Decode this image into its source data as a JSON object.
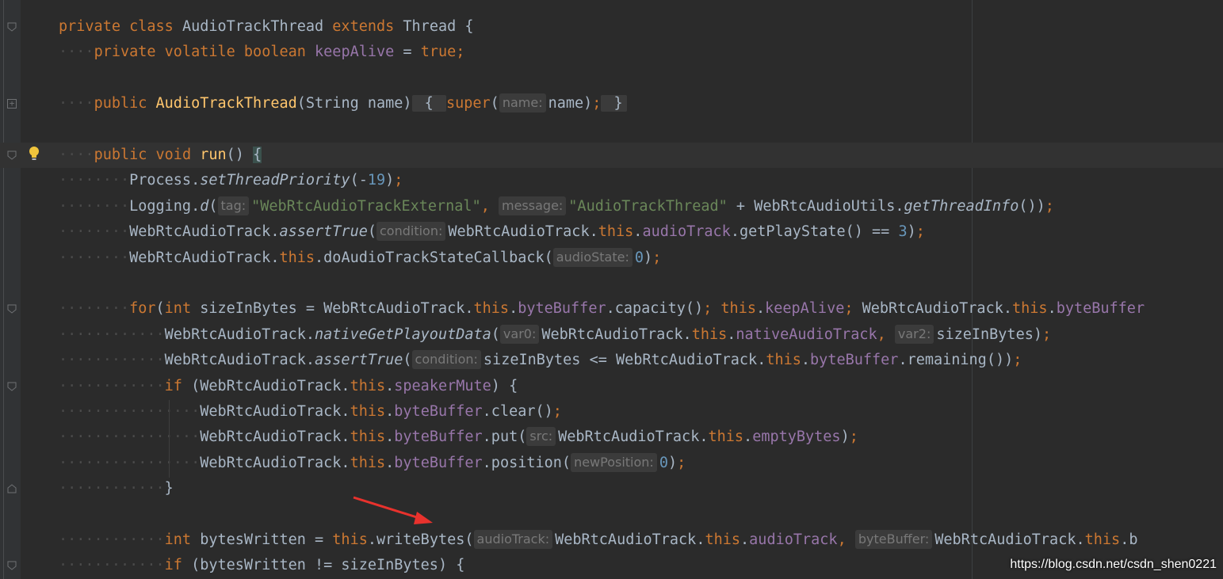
{
  "editor": {
    "lines": [
      {
        "dots": "",
        "tokens": [
          [
            "kw",
            "private "
          ],
          [
            "kw",
            "class "
          ],
          [
            "",
            "AudioTrackThread "
          ],
          [
            "kw",
            "extends "
          ],
          [
            "",
            "Thread {"
          ]
        ]
      },
      {
        "dots": "····",
        "tokens": [
          [
            "kw",
            "private "
          ],
          [
            "kw",
            "volatile "
          ],
          [
            "kw",
            "boolean "
          ],
          [
            "fld",
            "keepAlive"
          ],
          [
            "",
            " = "
          ],
          [
            "kw",
            "true"
          ],
          [
            "kw",
            ";"
          ]
        ]
      },
      {
        "dots": "",
        "tokens": []
      },
      {
        "dots": "····",
        "tokens": [
          [
            "kw",
            "public "
          ],
          [
            "mth",
            "AudioTrackThread"
          ],
          [
            "",
            "(String name)"
          ],
          [
            "fold",
            " { "
          ],
          [
            "kw",
            "super"
          ],
          [
            "",
            "("
          ],
          [
            "hint",
            "name:"
          ],
          [
            "",
            "name)"
          ],
          [
            "kw",
            ";"
          ],
          [
            "fold",
            " }"
          ]
        ]
      },
      {
        "dots": "",
        "tokens": []
      },
      {
        "dots": "····",
        "current": true,
        "tokens": [
          [
            "kw",
            "public "
          ],
          [
            "kw",
            "void "
          ],
          [
            "mth",
            "run"
          ],
          [
            "",
            "() "
          ],
          [
            "brace",
            "{"
          ]
        ]
      },
      {
        "dots": "········",
        "tokens": [
          [
            "",
            "Process."
          ],
          [
            "st",
            "setThreadPriority"
          ],
          [
            "",
            "(-"
          ],
          [
            "num",
            "19"
          ],
          [
            "",
            ")"
          ],
          [
            "kw",
            ";"
          ]
        ]
      },
      {
        "dots": "········",
        "tokens": [
          [
            "",
            "Logging."
          ],
          [
            "st",
            "d"
          ],
          [
            "",
            "("
          ],
          [
            "hint",
            "tag:"
          ],
          [
            "str",
            "\"WebRtcAudioTrackExternal\""
          ],
          [
            "kw",
            ","
          ],
          [
            "",
            " "
          ],
          [
            "hint",
            "message:"
          ],
          [
            "str",
            "\"AudioTrackThread\""
          ],
          [
            "",
            " + WebRtcAudioUtils."
          ],
          [
            "st",
            "getThreadInfo"
          ],
          [
            "",
            "())"
          ],
          [
            "kw",
            ";"
          ]
        ]
      },
      {
        "dots": "········",
        "tokens": [
          [
            "",
            "WebRtcAudioTrack."
          ],
          [
            "st",
            "assertTrue"
          ],
          [
            "",
            "("
          ],
          [
            "hint",
            "condition:"
          ],
          [
            "",
            "WebRtcAudioTrack."
          ],
          [
            "kw",
            "this"
          ],
          [
            "",
            "."
          ],
          [
            "fld",
            "audioTrack"
          ],
          [
            "",
            ".getPlayState() == "
          ],
          [
            "num",
            "3"
          ],
          [
            "",
            ")"
          ],
          [
            "kw",
            ";"
          ]
        ]
      },
      {
        "dots": "········",
        "tokens": [
          [
            "",
            "WebRtcAudioTrack."
          ],
          [
            "kw",
            "this"
          ],
          [
            "",
            ".doAudioTrackStateCallback("
          ],
          [
            "hint",
            "audioState:"
          ],
          [
            "num",
            "0"
          ],
          [
            "",
            ")"
          ],
          [
            "kw",
            ";"
          ]
        ]
      },
      {
        "dots": "",
        "tokens": []
      },
      {
        "dots": "········",
        "tokens": [
          [
            "kw",
            "for"
          ],
          [
            "",
            "("
          ],
          [
            "kw",
            "int "
          ],
          [
            "",
            "sizeInBytes = WebRtcAudioTrack."
          ],
          [
            "kw",
            "this"
          ],
          [
            "",
            "."
          ],
          [
            "fld",
            "byteBuffer"
          ],
          [
            "",
            ".capacity()"
          ],
          [
            "kw",
            "; this"
          ],
          [
            "",
            "."
          ],
          [
            "fld",
            "keepAlive"
          ],
          [
            "kw",
            "; "
          ],
          [
            "",
            "WebRtcAudioTrack."
          ],
          [
            "kw",
            "this"
          ],
          [
            "",
            "."
          ],
          [
            "fld",
            "byteBuffer"
          ]
        ]
      },
      {
        "dots": "············",
        "tokens": [
          [
            "",
            "WebRtcAudioTrack."
          ],
          [
            "st",
            "nativeGetPlayoutData"
          ],
          [
            "",
            "("
          ],
          [
            "hint",
            "var0:"
          ],
          [
            "",
            "WebRtcAudioTrack."
          ],
          [
            "kw",
            "this"
          ],
          [
            "",
            "."
          ],
          [
            "fld",
            "nativeAudioTrack"
          ],
          [
            "kw",
            ","
          ],
          [
            "",
            " "
          ],
          [
            "hint",
            "var2:"
          ],
          [
            "",
            "sizeInBytes)"
          ],
          [
            "kw",
            ";"
          ]
        ]
      },
      {
        "dots": "············",
        "tokens": [
          [
            "",
            "WebRtcAudioTrack."
          ],
          [
            "st",
            "assertTrue"
          ],
          [
            "",
            "("
          ],
          [
            "hint",
            "condition:"
          ],
          [
            "",
            "sizeInBytes <= WebRtcAudioTrack."
          ],
          [
            "kw",
            "this"
          ],
          [
            "",
            "."
          ],
          [
            "fld",
            "byteBuffer"
          ],
          [
            "",
            ".remaining())"
          ],
          [
            "kw",
            ";"
          ]
        ]
      },
      {
        "dots": "············",
        "tokens": [
          [
            "kw",
            "if "
          ],
          [
            "",
            "(WebRtcAudioTrack."
          ],
          [
            "kw",
            "this"
          ],
          [
            "",
            "."
          ],
          [
            "fld",
            "speakerMute"
          ],
          [
            "",
            ") {"
          ]
        ]
      },
      {
        "dots": "················",
        "tokens": [
          [
            "",
            "WebRtcAudioTrack."
          ],
          [
            "kw",
            "this"
          ],
          [
            "",
            "."
          ],
          [
            "fld",
            "byteBuffer"
          ],
          [
            "",
            ".clear()"
          ],
          [
            "kw",
            ";"
          ]
        ]
      },
      {
        "dots": "················",
        "tokens": [
          [
            "",
            "WebRtcAudioTrack."
          ],
          [
            "kw",
            "this"
          ],
          [
            "",
            "."
          ],
          [
            "fld",
            "byteBuffer"
          ],
          [
            "",
            ".put("
          ],
          [
            "hint",
            "src:"
          ],
          [
            "",
            "WebRtcAudioTrack."
          ],
          [
            "kw",
            "this"
          ],
          [
            "",
            "."
          ],
          [
            "fld",
            "emptyBytes"
          ],
          [
            "",
            ")"
          ],
          [
            "kw",
            ";"
          ]
        ]
      },
      {
        "dots": "················",
        "tokens": [
          [
            "",
            "WebRtcAudioTrack."
          ],
          [
            "kw",
            "this"
          ],
          [
            "",
            "."
          ],
          [
            "fld",
            "byteBuffer"
          ],
          [
            "",
            ".position("
          ],
          [
            "hint",
            "newPosition:"
          ],
          [
            "num",
            "0"
          ],
          [
            "",
            ")"
          ],
          [
            "kw",
            ";"
          ]
        ]
      },
      {
        "dots": "············",
        "tokens": [
          [
            "",
            "}"
          ]
        ]
      },
      {
        "dots": "",
        "tokens": []
      },
      {
        "dots": "············",
        "tokens": [
          [
            "kw",
            "int "
          ],
          [
            "",
            "bytesWritten = "
          ],
          [
            "kw",
            "this"
          ],
          [
            "",
            ".writeBytes("
          ],
          [
            "hint",
            "audioTrack:"
          ],
          [
            "",
            "WebRtcAudioTrack."
          ],
          [
            "kw",
            "this"
          ],
          [
            "",
            "."
          ],
          [
            "fld",
            "audioTrack"
          ],
          [
            "kw",
            ","
          ],
          [
            "",
            " "
          ],
          [
            "hint",
            "byteBuffer:"
          ],
          [
            "",
            "WebRtcAudioTrack."
          ],
          [
            "kw",
            "this"
          ],
          [
            "",
            ".b"
          ]
        ]
      },
      {
        "dots": "············",
        "tokens": [
          [
            "kw",
            "if "
          ],
          [
            "",
            "(bytesWritten != sizeInBytes) {"
          ]
        ]
      }
    ]
  },
  "gutter": {
    "icons": [
      {
        "type": "fold-open",
        "line": 0
      },
      {
        "type": "fold-closed",
        "line": 3
      },
      {
        "type": "fold-open",
        "line": 5
      },
      {
        "type": "fold-open",
        "line": 11
      },
      {
        "type": "fold-open",
        "line": 14
      },
      {
        "type": "fold-close-end",
        "line": 18
      },
      {
        "type": "fold-open",
        "line": 21
      }
    ],
    "intention_icon": "lightbulb-icon"
  },
  "annotation": {
    "arrow_color": "#e8322d"
  },
  "watermark": "https://blog.csdn.net/csdn_shen0221",
  "colors": {
    "background": "#2b2b2b",
    "keyword": "#cc7832",
    "field": "#9876aa",
    "method_decl": "#ffc66d",
    "string": "#6a8759",
    "number": "#6897bb",
    "default": "#a9b7c6"
  }
}
